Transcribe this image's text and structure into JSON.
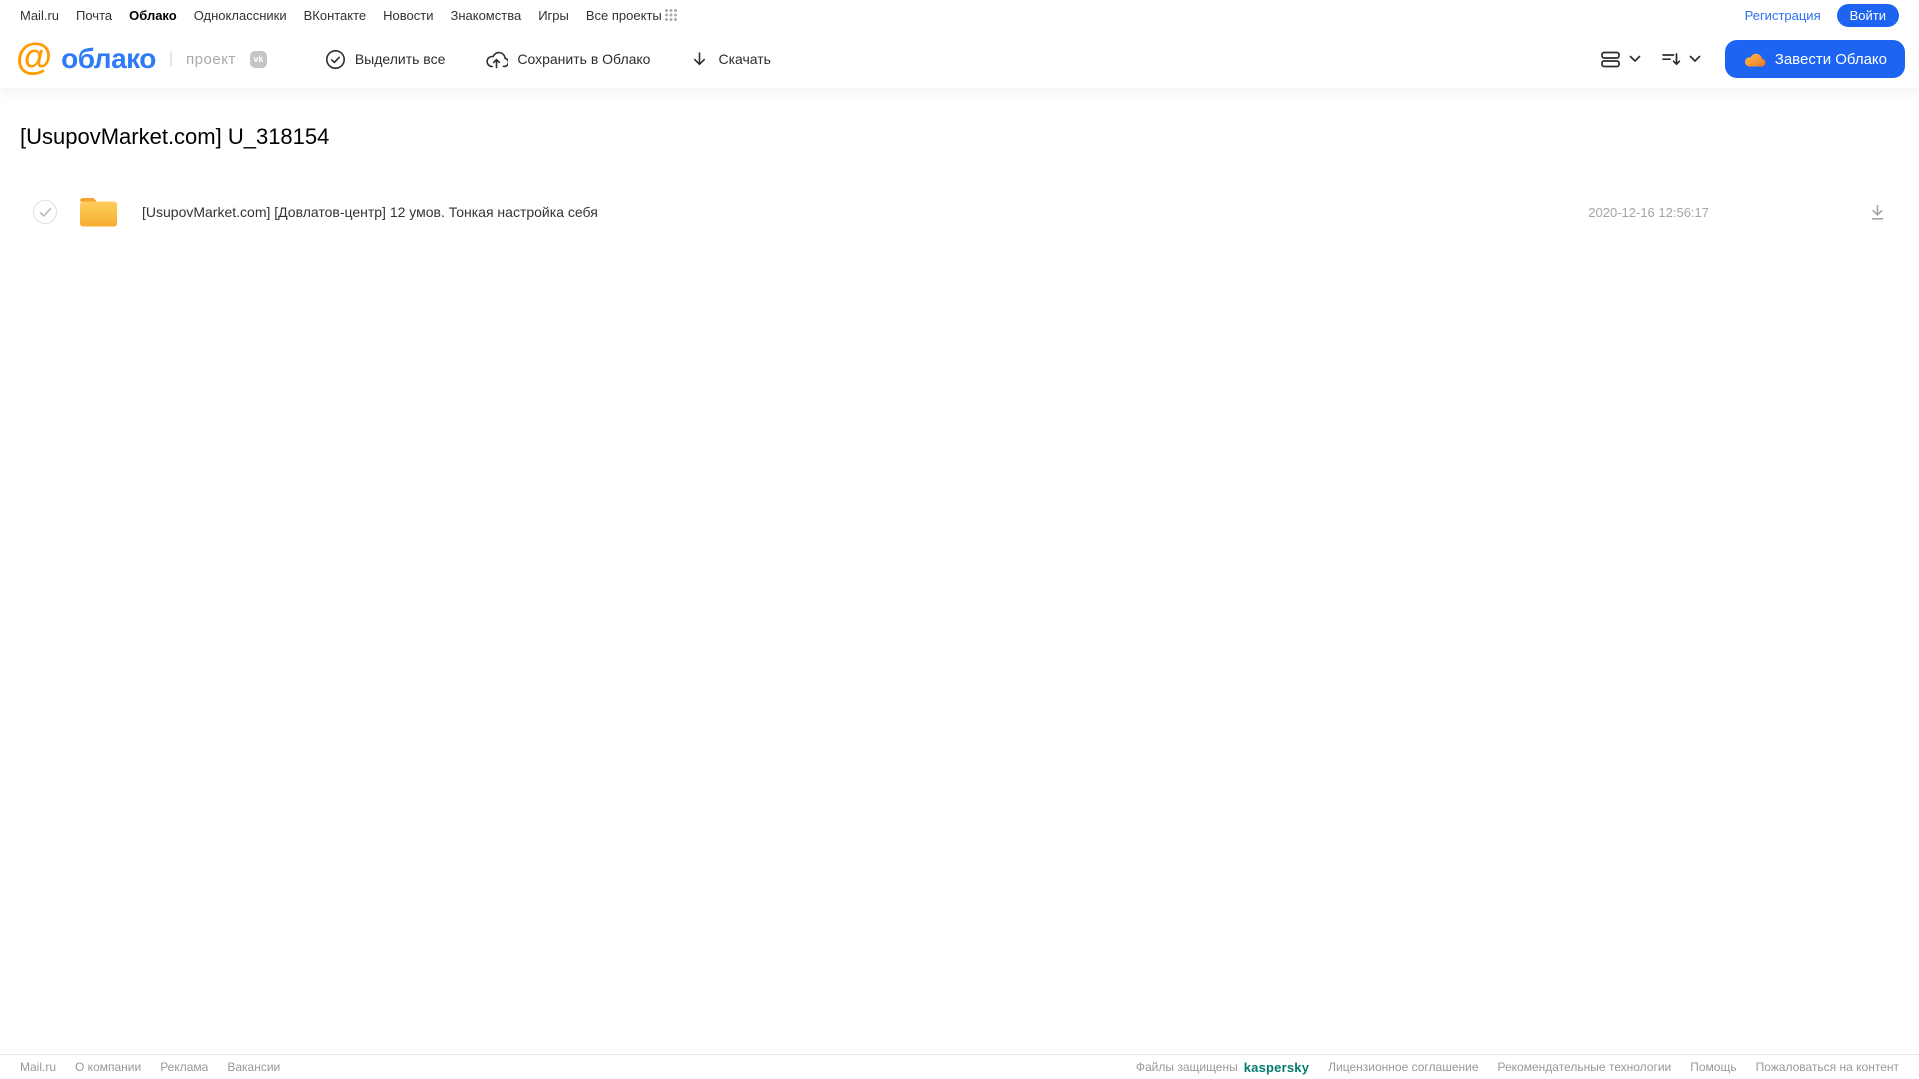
{
  "topnav": {
    "links": [
      {
        "label": "Mail.ru",
        "active": false
      },
      {
        "label": "Почта",
        "active": false
      },
      {
        "label": "Облако",
        "active": true
      },
      {
        "label": "Одноклассники",
        "active": false
      },
      {
        "label": "ВКонтакте",
        "active": false
      },
      {
        "label": "Новости",
        "active": false
      },
      {
        "label": "Знакомства",
        "active": false
      },
      {
        "label": "Игры",
        "active": false
      },
      {
        "label": "Все проекты",
        "active": false
      }
    ],
    "register_label": "Регистрация",
    "login_label": "Войти"
  },
  "header": {
    "logo_at": "@",
    "logo_text": "облако",
    "divider": "|",
    "project_label": "проект",
    "vk_badge": "vk",
    "actions": {
      "select_all": "Выделить все",
      "save_to_cloud": "Сохранить в Облако",
      "download": "Скачать"
    },
    "get_cloud_label": "Завести Облако"
  },
  "main": {
    "title": "[UsupovMarket.com] U_318154",
    "files": [
      {
        "type": "folder",
        "name": "[UsupovMarket.com] [Довлатов-центр] 12 умов. Тонкая настройка себя",
        "date": "2020-12-16 12:56:17"
      }
    ]
  },
  "footer": {
    "left_links": [
      "Mail.ru",
      "О компании",
      "Реклама",
      "Вакансии"
    ],
    "protected_label": "Файлы защищены",
    "kaspersky_label": "kaspersky",
    "right_links": [
      "Лицензионное соглашение",
      "Рекомендательные технологии",
      "Помощь",
      "Пожаловаться на контент"
    ]
  },
  "colors": {
    "accent_blue": "#1d64f2",
    "logo_blue": "#2d7bf6",
    "logo_orange": "#ff9b00",
    "folder_yellow_top": "#ffce5e",
    "folder_yellow_bottom": "#f7ad31",
    "kaspersky_teal": "#007d6c",
    "muted_gray": "#999999"
  }
}
